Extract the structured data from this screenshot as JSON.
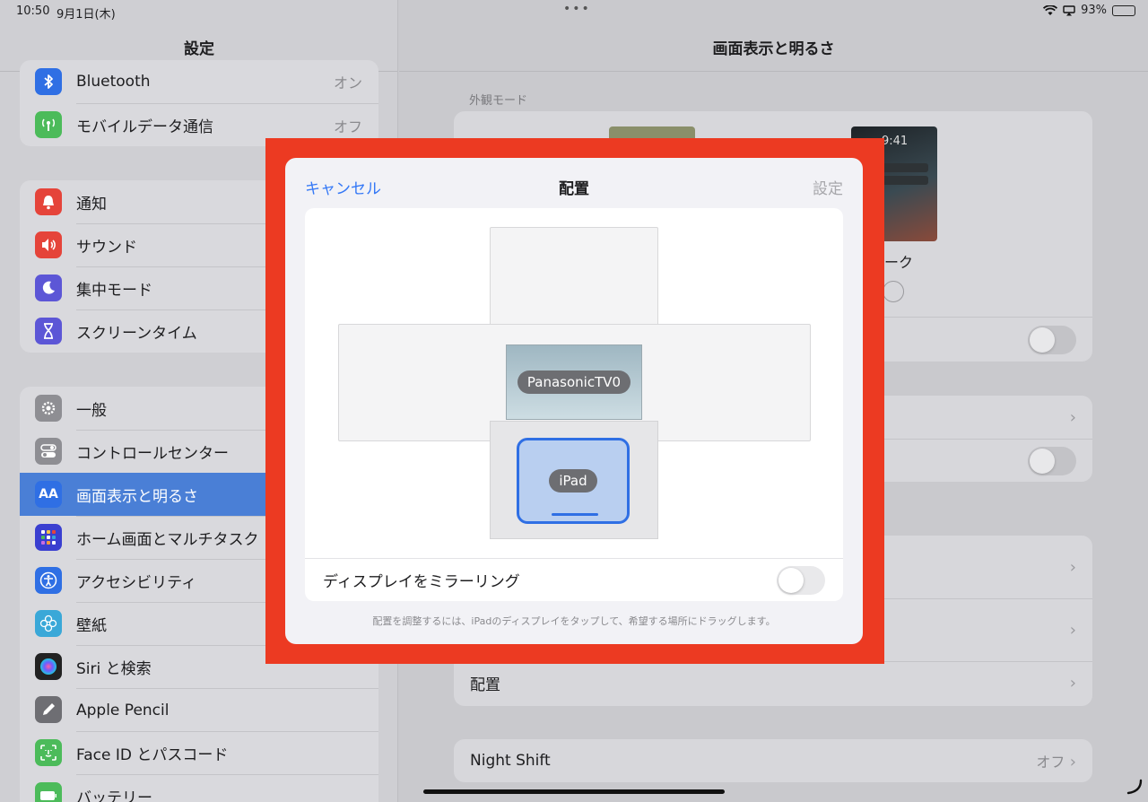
{
  "status": {
    "time": "10:50",
    "date": "9月1日(木)",
    "battery": "93%",
    "battery_level": 0.93
  },
  "sidebar": {
    "title": "設定",
    "groups": [
      [
        {
          "label": "Bluetooth",
          "value": "オン",
          "icon": "bluetooth-icon",
          "color": "#2f6fe4"
        },
        {
          "label": "モバイルデータ通信",
          "value": "オフ",
          "icon": "antenna-icon",
          "color": "#4cbb5a"
        }
      ],
      [
        {
          "label": "通知",
          "icon": "bell-icon",
          "color": "#e5443a"
        },
        {
          "label": "サウンド",
          "icon": "speaker-icon",
          "color": "#e5443a"
        },
        {
          "label": "集中モード",
          "icon": "moon-icon",
          "color": "#5c56d6"
        },
        {
          "label": "スクリーンタイム",
          "icon": "hourglass-icon",
          "color": "#5c56d6"
        }
      ],
      [
        {
          "label": "一般",
          "icon": "gear-icon",
          "color": "#8e8e93"
        },
        {
          "label": "コントロールセンター",
          "icon": "toggles-icon",
          "color": "#8e8e93"
        },
        {
          "label": "画面表示と明るさ",
          "icon": "aa-icon",
          "color": "#2f6fe4",
          "selected": true
        },
        {
          "label": "ホーム画面とマルチタスク",
          "icon": "grid-icon",
          "color": "#3a3fd0"
        },
        {
          "label": "アクセシビリティ",
          "icon": "accessibility-icon",
          "color": "#2f6fe4"
        },
        {
          "label": "壁紙",
          "icon": "flower-icon",
          "color": "#3aa8d8"
        },
        {
          "label": "Siri と検索",
          "icon": "siri-icon",
          "color": "#222222"
        },
        {
          "label": "Apple Pencil",
          "icon": "pencil-icon",
          "color": "#6e6e73"
        },
        {
          "label": "Face ID とパスコード",
          "icon": "faceid-icon",
          "color": "#4cbb5a"
        },
        {
          "label": "バッテリー",
          "icon": "battery-icon",
          "color": "#4cbb5a"
        }
      ]
    ]
  },
  "detail": {
    "title": "画面表示と明るさ",
    "appearance_label": "外観モード",
    "dark_time": "9:41",
    "dark_label": "ダーク",
    "arrangement_label": "配置",
    "night_shift_label": "Night Shift",
    "night_shift_value": "オフ"
  },
  "modal": {
    "cancel": "キャンセル",
    "title": "配置",
    "set": "設定",
    "tv_name": "PanasonicTV0",
    "ipad_name": "iPad",
    "mirror_label": "ディスプレイをミラーリング",
    "hint": "配置を調整するには、iPadのディスプレイをタップして、希望する場所にドラッグします。"
  },
  "colors": {
    "accent": "#3478f6",
    "highlight_frame": "#ec3a22"
  }
}
